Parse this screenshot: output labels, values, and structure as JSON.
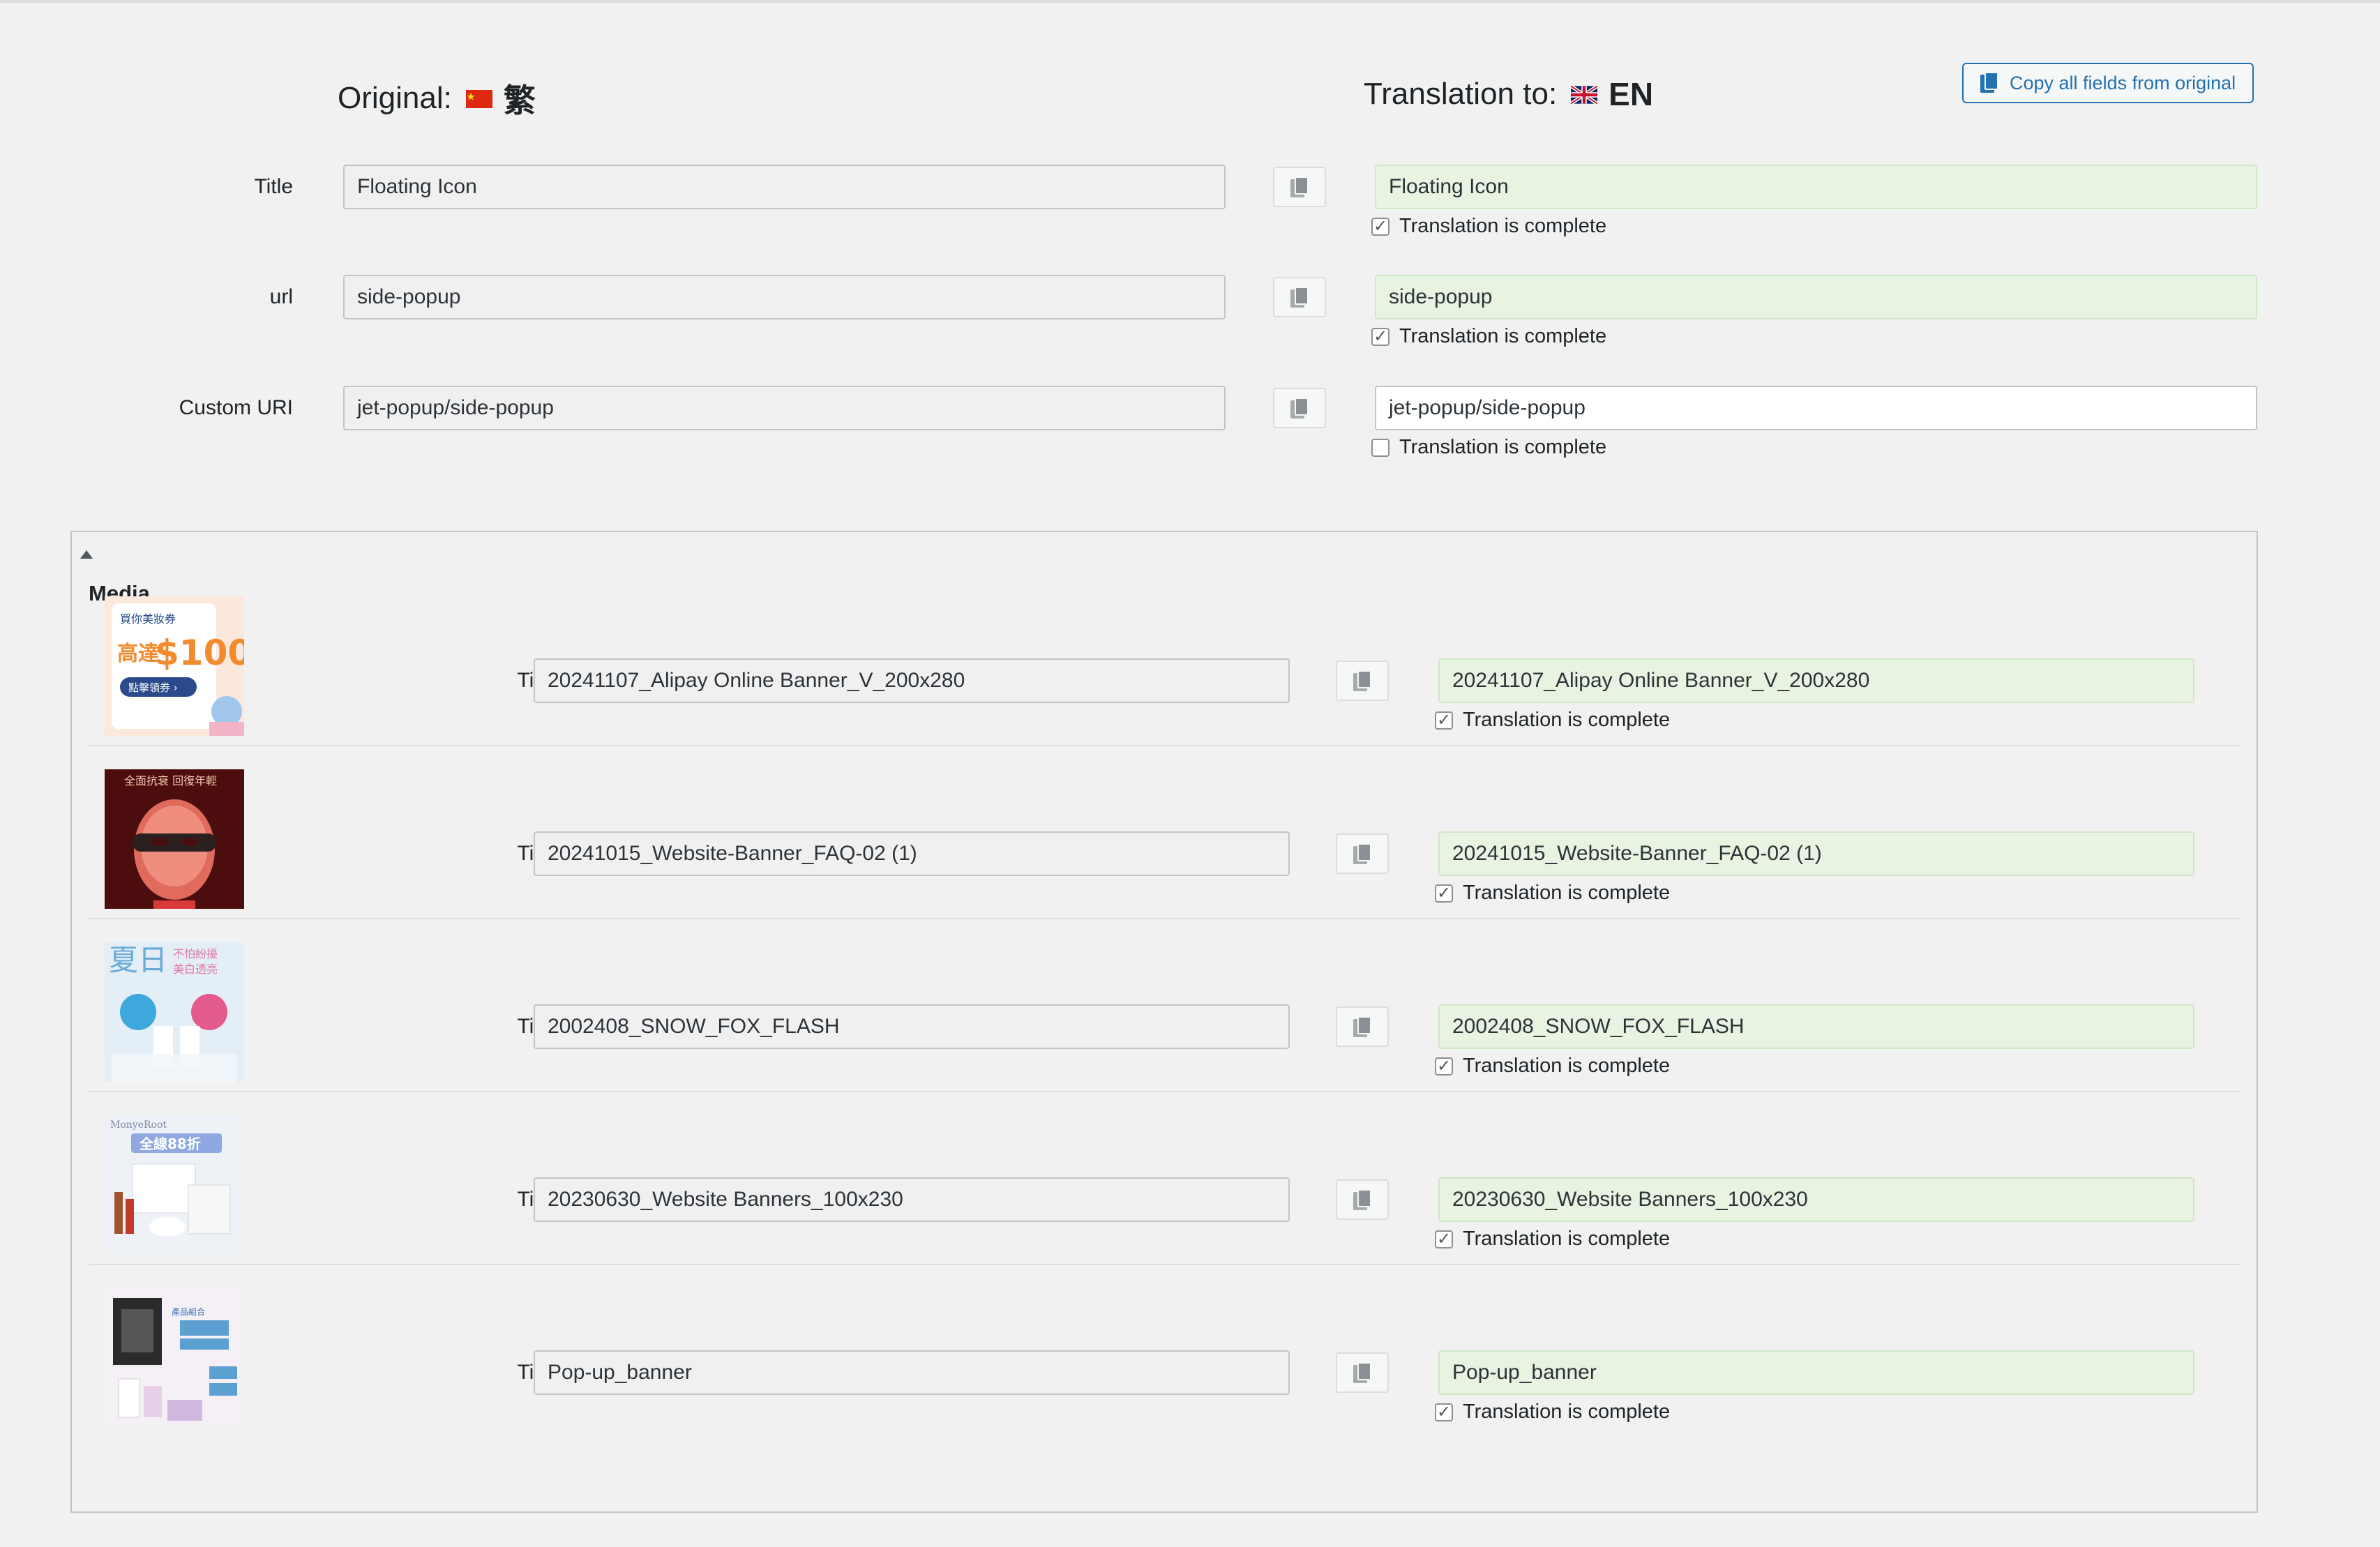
{
  "header": {
    "original_label": "Original:",
    "original_lang": "繁",
    "translation_label": "Translation to:",
    "translation_lang": "EN",
    "copy_all_label": "Copy all fields from original"
  },
  "fields": [
    {
      "label": "Title",
      "original": "Floating Icon",
      "translation": "Floating Icon",
      "complete": true,
      "complete_label": "Translation is complete"
    },
    {
      "label": "url",
      "original": "side-popup",
      "translation": "side-popup",
      "complete": true,
      "complete_label": "Translation is complete"
    },
    {
      "label": "Custom URI",
      "original": "jet-popup/side-popup",
      "translation": "jet-popup/side-popup",
      "complete": false,
      "complete_label": "Translation is complete"
    }
  ],
  "media": {
    "section_title": "Media",
    "items": [
      {
        "label": "Title",
        "original": "20241107_Alipay Online Banner_V_200x280",
        "translation": "20241107_Alipay Online Banner_V_200x280",
        "complete": true,
        "complete_label": "Translation is complete",
        "thumb_text": "$100",
        "thumb_text2": "高達",
        "thumb_top": "買你美妝券",
        "thumb_btn": "點擊領券 ›"
      },
      {
        "label": "Title",
        "original": "20241015_Website-Banner_FAQ-02 (1)",
        "translation": "20241015_Website-Banner_FAQ-02 (1)",
        "complete": true,
        "complete_label": "Translation is complete",
        "thumb_top": "全面抗衰 回復年輕"
      },
      {
        "label": "Title",
        "original": "2002408_SNOW_FOX_FLASH",
        "translation": "2002408_SNOW_FOX_FLASH",
        "complete": true,
        "complete_label": "Translation is complete",
        "thumb_top": "夏日",
        "thumb_text2": "不怕紛擾 美白透亮"
      },
      {
        "label": "Title",
        "original": "20230630_Website Banners_100x230",
        "translation": "20230630_Website Banners_100x230",
        "complete": true,
        "complete_label": "Translation is complete",
        "thumb_top": "全線88折"
      },
      {
        "label": "Title",
        "original": "Pop-up_banner",
        "translation": "Pop-up_banner",
        "complete": true,
        "complete_label": "Translation is complete",
        "thumb_top": "產品組合"
      }
    ]
  },
  "colors": {
    "accent": "#2271b1",
    "complete_bg": "#e6f4e1",
    "original_bg": "#f0f0f1"
  }
}
